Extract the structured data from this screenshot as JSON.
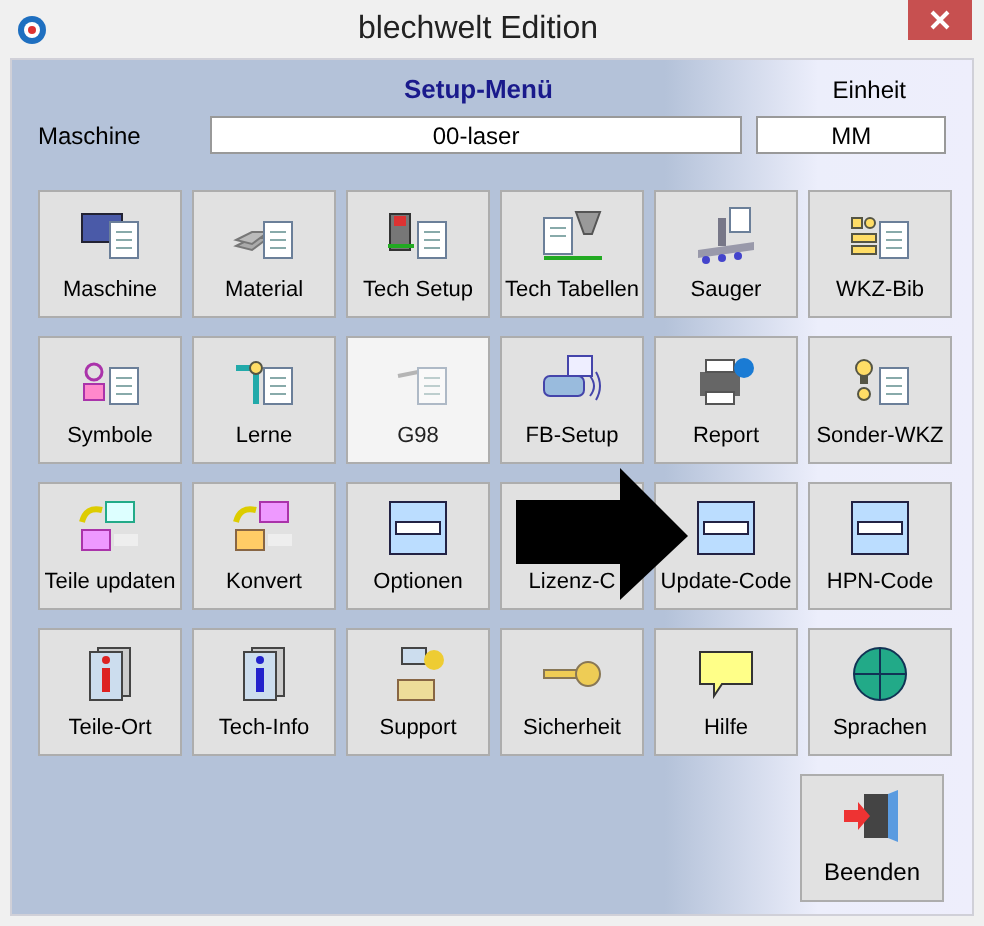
{
  "window": {
    "title": "blechwelt Edition"
  },
  "header": {
    "title": "Setup-Menü",
    "unit_label": "Einheit",
    "machine_label": "Maschine",
    "machine_value": "00-laser",
    "unit_value": "MM"
  },
  "buttons": [
    {
      "label": "Maschine",
      "disabled": false
    },
    {
      "label": "Material",
      "disabled": false
    },
    {
      "label": "Tech Setup",
      "disabled": false
    },
    {
      "label": "Tech Tabellen",
      "disabled": false
    },
    {
      "label": "Sauger",
      "disabled": false
    },
    {
      "label": "WKZ-Bib",
      "disabled": false
    },
    {
      "label": "Symbole",
      "disabled": false
    },
    {
      "label": "Lerne",
      "disabled": false
    },
    {
      "label": "G98",
      "disabled": true
    },
    {
      "label": "FB-Setup",
      "disabled": false
    },
    {
      "label": "Report",
      "disabled": false
    },
    {
      "label": "Sonder-WKZ",
      "disabled": false
    },
    {
      "label": "Teile updaten",
      "disabled": false
    },
    {
      "label": "Konvert",
      "disabled": false
    },
    {
      "label": "Optionen",
      "disabled": false
    },
    {
      "label": "Lizenz-C",
      "disabled": false
    },
    {
      "label": "Update-Code",
      "disabled": false
    },
    {
      "label": "HPN-Code",
      "disabled": false
    },
    {
      "label": "Teile-Ort",
      "disabled": false
    },
    {
      "label": "Tech-Info",
      "disabled": false
    },
    {
      "label": "Support",
      "disabled": false
    },
    {
      "label": "Sicherheit",
      "disabled": false
    },
    {
      "label": "Hilfe",
      "disabled": false
    },
    {
      "label": "Sprachen",
      "disabled": false
    }
  ],
  "exit_button": {
    "label": "Beenden"
  }
}
